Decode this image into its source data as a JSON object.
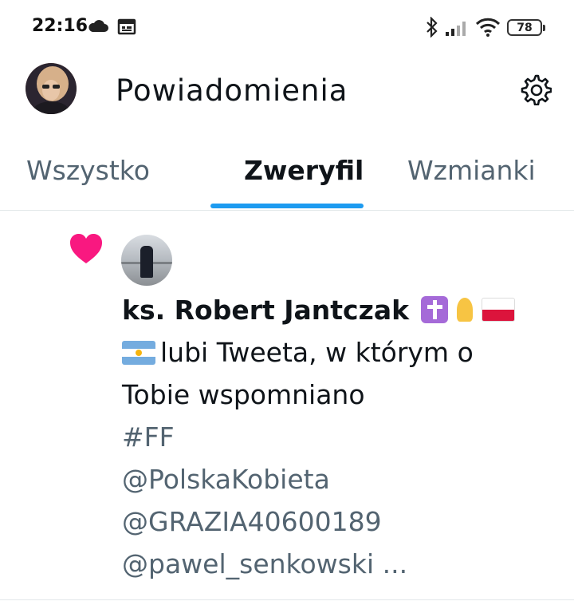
{
  "status_bar": {
    "time": "22:16",
    "battery": "78",
    "left_icons": [
      "cloud-icon",
      "calendar-icon"
    ],
    "right_icons": [
      "bluetooth-icon",
      "signal-icon",
      "wifi-icon",
      "battery-icon"
    ]
  },
  "header": {
    "title": "Powiadomienia",
    "settings_icon": "gear-icon"
  },
  "tabs": [
    {
      "label": "Wszystko",
      "active": false
    },
    {
      "label": "Zweryfil",
      "active": true
    },
    {
      "label": "Wzmianki",
      "active": false
    }
  ],
  "notification": {
    "type_icon": "heart-icon",
    "user_name": "ks. Robert Jantczak",
    "name_emojis": [
      "latin-cross-emoji",
      "folded-hands-emoji",
      "poland-flag-emoji",
      "argentina-flag-emoji"
    ],
    "action_line_1": "lubi Tweeta, w którym o",
    "action_line_2": "Tobie wspomniano",
    "tweet_lines": [
      "#FF",
      "@PolskaKobieta",
      "@GRAZIA40600189",
      "@pawel_senkowski ..."
    ]
  },
  "colors": {
    "accent": "#1d9bf0",
    "heart": "#f91880",
    "secondary_text": "#536471",
    "primary_text": "#0f1419"
  }
}
